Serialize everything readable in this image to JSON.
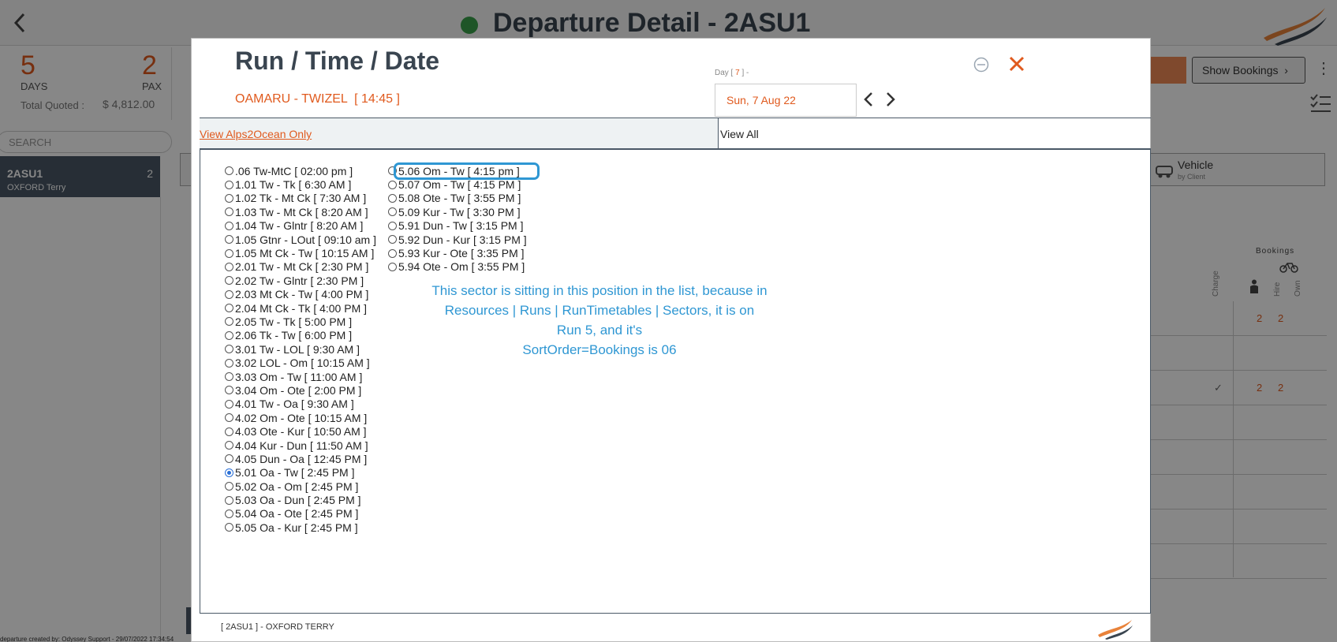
{
  "page": {
    "title": "Departure Detail - 2ASU1",
    "status_color": "#3aa04a"
  },
  "summary": {
    "days": "5",
    "days_label": "DAYS",
    "pax": "2",
    "pax_label": "PAX",
    "total_quoted_label": "Total Quoted :",
    "total_quoted_value": "$ 4,812.00"
  },
  "search": {
    "placeholder": "SEARCH"
  },
  "departure_item": {
    "code": "2ASU1",
    "name": "OXFORD Terry",
    "count": "2"
  },
  "right_panel": {
    "orange_button": "**",
    "show_bookings": "Show Bookings",
    "vehicle_tab": "Vehicle",
    "vehicle_sub": "by Client",
    "bookings_header": "Bookings",
    "columns": [
      "Charge",
      "Hire",
      "Own"
    ],
    "rows": [
      {
        "charge": "",
        "pax": "2",
        "hire": "2"
      },
      {
        "charge": "",
        "pax": "",
        "hire": ""
      },
      {
        "charge": "✓",
        "pax": "2",
        "hire": "2"
      }
    ]
  },
  "footer_note": "departure created by: Odyssey Support - 29/07/2022 17:34:54",
  "modal": {
    "title": "Run / Time / Date",
    "route": "OAMARU - TWIZEL  [ 14:45 ]",
    "day_prefix": "Day [",
    "day_number": "7",
    "day_suffix": "] -",
    "date_value": "Sun, 7 Aug 22",
    "filter_alps": "View Alps2Ocean Only",
    "filter_all": "View All",
    "selected_run": "5.01 Oa - Tw [ 2:45 PM ]",
    "highlighted_run": "5.06 Om - Tw [ 4:15 pm ]",
    "runs_col1": [
      ".06 Tw-MtC [ 02:00 pm ]",
      "1.01 Tw - Tk [ 6:30 AM ]",
      "1.02 Tk - Mt Ck [ 7:30 AM ]",
      "1.03 Tw - Mt Ck [ 8:20 AM ]",
      "1.04 Tw - Glntr [ 8:20 AM ]",
      "1.05 Gtnr - LOut [ 09:10 am ]",
      "1.05 Mt Ck - Tw [ 10:15 AM ]",
      "2.01 Tw - Mt Ck [ 2:30 PM ]",
      "2.02 Tw - Glntr [ 2:30 PM ]",
      "2.03 Mt Ck - Tw [ 4:00 PM ]",
      "2.04 Mt Ck - Tk [ 4:00 PM ]",
      "2.05 Tw - Tk [ 5:00 PM ]",
      "2.06 Tk - Tw [ 6:00 PM ]",
      "3.01 Tw - LOL [ 9:30 AM ]",
      "3.02 LOL - Om [ 10:15 AM ]",
      "3.03 Om - Tw [ 11:00 AM ]",
      "3.04 Om - Ote [ 2:00 PM ]",
      "4.01 Tw - Oa [ 9:30 AM ]",
      "4.02 Om - Ote [ 10:15 AM ]",
      "4.03 Ote - Kur [ 10:50 AM ]",
      "4.04 Kur - Dun [ 11:50 AM ]",
      "4.05 Dun - Oa [ 12:45 PM ]",
      "5.01 Oa - Tw [ 2:45 PM ]",
      "5.02 Oa - Om [ 2:45 PM ]",
      "5.03 Oa - Dun [ 2:45 PM ]",
      "5.04 Oa - Ote [ 2:45 PM ]",
      "5.05 Oa - Kur [ 2:45 PM ]"
    ],
    "runs_col2": [
      "5.06 Om - Tw [ 4:15 pm ]",
      "5.07 Om - Tw [ 4:15 PM ]",
      "5.08 Ote - Tw [ 3:55 PM ]",
      "5.09 Kur - Tw [ 3:30 PM ]",
      "5.91 Dun - Tw [ 3:15 PM ]",
      "5.92 Dun - Kur [ 3:15 PM ]",
      "5.93 Kur - Ote [ 3:35 PM ]",
      "5.94 Ote - Om [ 3:55 PM ]"
    ],
    "annotation_lines": [
      "This sector is sitting in this position in the list, because in",
      "Resources | Runs | RunTimetables | Sectors, it is on",
      "Run 5, and it's",
      "SortOrder=Bookings is 06"
    ],
    "footer": "[ 2ASU1 ] - OXFORD TERRY"
  },
  "colors": {
    "accent_orange": "#e05a1e",
    "annotation_blue": "#2f97d3",
    "header_dark": "#3a4550"
  }
}
